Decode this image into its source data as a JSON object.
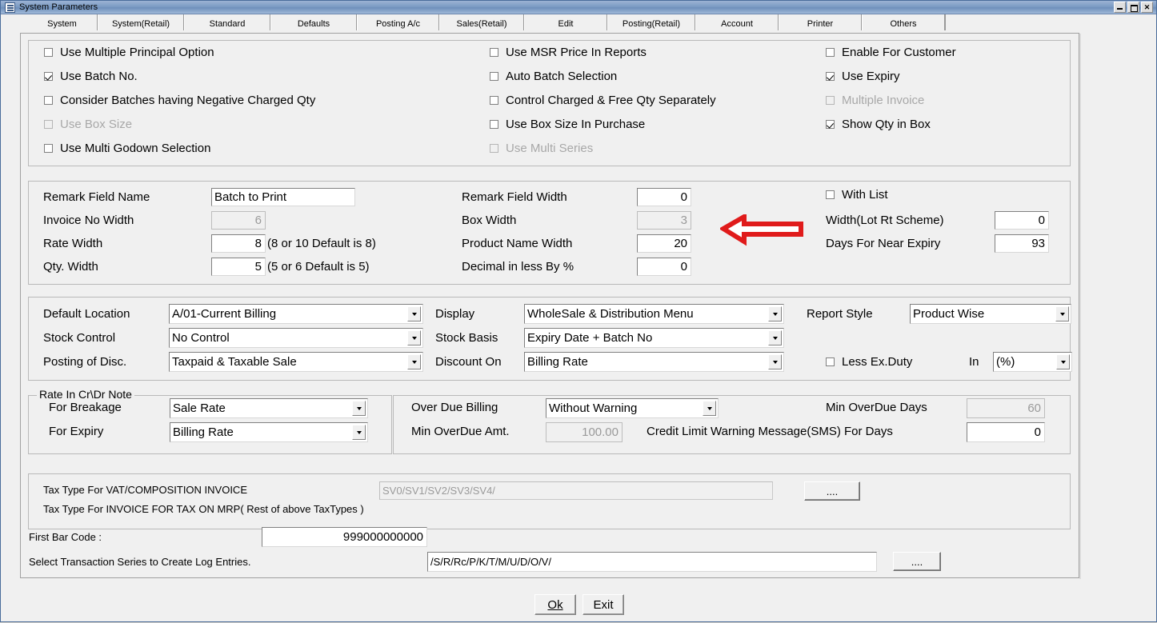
{
  "window": {
    "title": "System Parameters",
    "icon": "window-menu-icon",
    "buttons": {
      "minimize": "_",
      "maximize": "□",
      "close": "✕"
    }
  },
  "tabs": [
    {
      "label": "System",
      "active": true
    },
    {
      "label": "System(Retail)",
      "active": false
    },
    {
      "label": "Standard",
      "active": false
    },
    {
      "label": "Defaults",
      "active": false
    },
    {
      "label": "Posting A/c",
      "active": false
    },
    {
      "label": "Sales(Retail)",
      "active": false
    },
    {
      "label": "Edit",
      "active": false
    },
    {
      "label": "Posting(Retail)",
      "active": false
    },
    {
      "label": "Account",
      "active": false
    },
    {
      "label": "Printer",
      "active": false
    },
    {
      "label": "Others",
      "active": false
    }
  ],
  "options_group": {
    "column1": [
      {
        "label": "Use Multiple Principal Option",
        "checked": false,
        "disabled": false
      },
      {
        "label": "Use Batch No.",
        "checked": true,
        "disabled": false
      },
      {
        "label": "Consider Batches having Negative Charged Qty",
        "checked": false,
        "disabled": false
      },
      {
        "label": "Use Box Size",
        "checked": false,
        "disabled": true
      },
      {
        "label": "Use Multi Godown Selection",
        "checked": false,
        "disabled": false
      }
    ],
    "column2": [
      {
        "label": "Use MSR  Price In Reports",
        "checked": false,
        "disabled": false
      },
      {
        "label": "Auto Batch Selection",
        "checked": false,
        "disabled": false
      },
      {
        "label": "Control Charged & Free Qty Separately",
        "checked": false,
        "disabled": false
      },
      {
        "label": "Use Box Size In Purchase",
        "checked": false,
        "disabled": false
      },
      {
        "label": "Use Multi Series",
        "checked": false,
        "disabled": true
      }
    ],
    "column3": [
      {
        "label": "Enable For Customer",
        "checked": false,
        "disabled": false
      },
      {
        "label": "Use Expiry",
        "checked": true,
        "disabled": false
      },
      {
        "label": "Multiple Invoice",
        "checked": false,
        "disabled": true
      },
      {
        "label": "Show Qty in Box",
        "checked": true,
        "disabled": false
      }
    ]
  },
  "widths_group": {
    "remark_field_name": {
      "label": "Remark Field Name",
      "value": "Batch to Print"
    },
    "invoice_no_width": {
      "label": "Invoice No Width",
      "value": "6",
      "readonly": true
    },
    "rate_width": {
      "label": "Rate Width",
      "value": "8",
      "hint": "(8 or 10 Default is 8)"
    },
    "qty_width": {
      "label": "Qty. Width",
      "value": "5",
      "hint": "(5 or 6 Default is 5)"
    },
    "remark_field_width": {
      "label": "Remark Field Width",
      "value": "0"
    },
    "box_width": {
      "label": "Box Width",
      "value": "3",
      "readonly": true
    },
    "product_name_width": {
      "label": "Product Name Width",
      "value": "20"
    },
    "decimal_in_less_by": {
      "label": "Decimal in less By %",
      "value": "0"
    },
    "with_list": {
      "label": "With List",
      "checked": false
    },
    "width_lot_rt_scheme": {
      "label": "Width(Lot Rt Scheme)",
      "value": "0"
    },
    "days_for_near_expiry": {
      "label": "Days For Near Expiry",
      "value": "93"
    },
    "annotation": "red-left-arrow pointing at Remark Field Width"
  },
  "settings_group": {
    "default_location": {
      "label": "Default Location",
      "value": "A/01-Current Billing"
    },
    "stock_control": {
      "label": "Stock Control",
      "value": "No Control"
    },
    "posting_of_disc": {
      "label": "Posting of Disc.",
      "value": "Taxpaid & Taxable Sale"
    },
    "display": {
      "label": "Display",
      "value": "WholeSale & Distribution Menu"
    },
    "stock_basis": {
      "label": "Stock Basis",
      "value": "Expiry Date + Batch No"
    },
    "discount_on": {
      "label": "Discount On",
      "value": "Billing Rate"
    },
    "report_style": {
      "label": "Report Style",
      "value": "Product Wise"
    },
    "less_ex_duty": {
      "label": "Less Ex.Duty",
      "checked": false
    },
    "in_label": "In",
    "in_unit": {
      "value": "(%)"
    }
  },
  "rate_note_group": {
    "legend": "Rate In Cr\\Dr Note",
    "for_breakage": {
      "label": "For Breakage",
      "value": "Sale Rate"
    },
    "for_expiry": {
      "label": "For Expiry",
      "value": "Billing Rate"
    }
  },
  "overdue_group": {
    "over_due_billing": {
      "label": "Over Due Billing",
      "value": "Without Warning"
    },
    "min_overdue_amt": {
      "label": "Min OverDue Amt.",
      "value": "100.00",
      "readonly": true
    },
    "min_overdue_days": {
      "label": "Min OverDue Days",
      "value": "60",
      "readonly": true
    },
    "credit_limit_warning": {
      "label": "Credit Limit Warning Message(SMS) For Days",
      "value": "0"
    }
  },
  "tax_group": {
    "line1_label": "Tax Type For VAT/COMPOSITION INVOICE",
    "line1_value": "SV0/SV1/SV2/SV3/SV4/",
    "line2_label": "Tax Type For INVOICE FOR TAX ON MRP( Rest of above TaxTypes )",
    "browse_button": "...."
  },
  "bottom_fields": {
    "first_bar_code": {
      "label": "First Bar Code :",
      "value": "999000000000"
    },
    "transaction_series": {
      "label": "Select Transaction Series to Create Log Entries.",
      "value": "/S/R/Rc/P/K/T/M/U/D/O/V/"
    },
    "browse_button": "...."
  },
  "footer": {
    "ok": {
      "label": "Ok",
      "accel": "O"
    },
    "exit": {
      "label": "Exit",
      "accel": "x"
    }
  },
  "colors": {
    "titlebar": "#7d9cc4",
    "panel": "#f0f0f0",
    "annotation_red": "#e01b1b",
    "field_bg": "#ffffff",
    "disabled_text": "#a8a8a8"
  }
}
